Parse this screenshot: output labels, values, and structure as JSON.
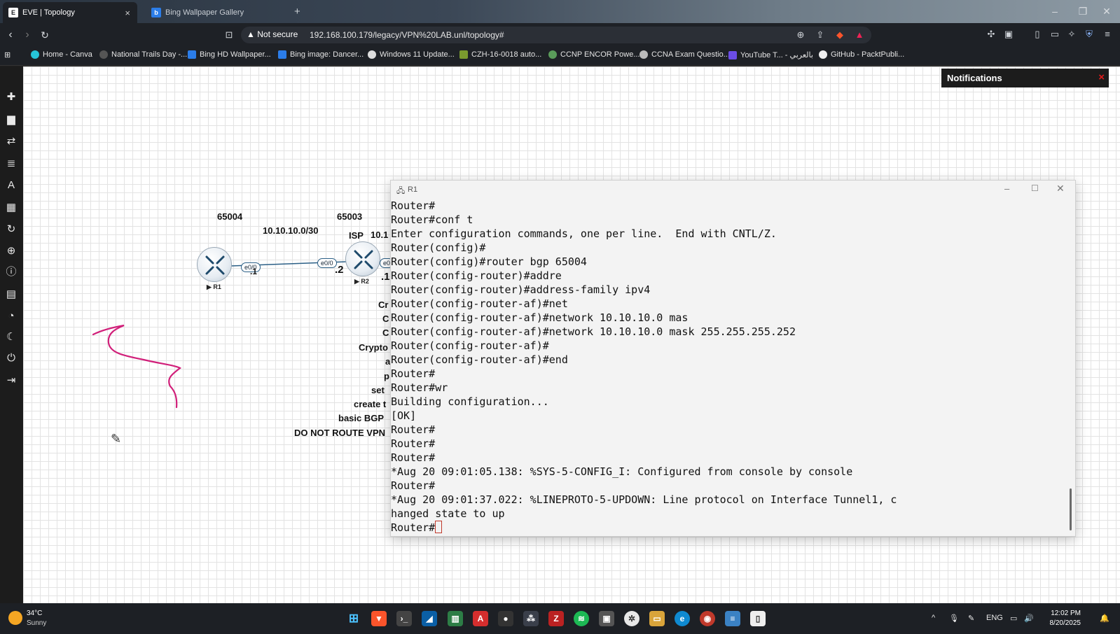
{
  "browser": {
    "tabs": [
      {
        "title": "EVE | Topology",
        "active": true
      },
      {
        "title": "Bing Wallpaper Gallery",
        "active": false
      }
    ],
    "new_tab": "+",
    "security_label": "Not secure",
    "url": "192.168.100.179/legacy/VPN%20LAB.unl/topology#",
    "bookmarks": [
      "Home - Canva",
      "National Trails Day -...",
      "Bing HD Wallpaper...",
      "Bing image: Dancer...",
      "Windows 11 Update...",
      "CZH-16-0018 auto...",
      "CCNP ENCOR Powe...",
      "CCNA Exam Questio...",
      "YouTube T... - بالعربي",
      "GitHub - PacktPubli..."
    ]
  },
  "notifications": {
    "title": "Notifications",
    "close": "×"
  },
  "topology": {
    "as_left": "65004",
    "as_right": "65003",
    "link_subnet": "10.10.10.0/30",
    "isp_label": "ISP",
    "isp_ip_partial": "10.1",
    "r1_iface": "e0/0",
    "r2_iface": "e0/0",
    "r2_iface_right": "e0",
    "r1_host": ".1",
    "r2_host": ".2",
    "r2_host_right": ".1",
    "r1_name": "R1",
    "r2_name": "R2",
    "notes": [
      "Cr",
      "C",
      "C",
      "Crypto",
      "a",
      "p",
      "set",
      "create t",
      "basic BGP",
      "DO NOT ROUTE VPN"
    ]
  },
  "console": {
    "title": "R1",
    "lines": [
      "Router#",
      "Router#conf t",
      "Enter configuration commands, one per line.  End with CNTL/Z.",
      "Router(config)#",
      "Router(config)#router bgp 65004",
      "Router(config-router)#addre",
      "Router(config-router)#address-family ipv4",
      "Router(config-router-af)#net",
      "Router(config-router-af)#network 10.10.10.0 mas",
      "Router(config-router-af)#network 10.10.10.0 mask 255.255.255.252",
      "Router(config-router-af)#",
      "Router(config-router-af)#end",
      "Router#",
      "Router#wr",
      "Building configuration...",
      "[OK]",
      "Router#",
      "Router#",
      "Router#",
      "*Aug 20 09:01:05.138: %SYS-5-CONFIG_I: Configured from console by console",
      "Router#",
      "*Aug 20 09:01:37.022: %LINEPROTO-5-UPDOWN: Line protocol on Interface Tunnel1, c",
      "hanged state to up"
    ],
    "prompt": "Router#"
  },
  "taskbar": {
    "weather_temp": "34°C",
    "weather_desc": "Sunny",
    "lang": "ENG",
    "time": "12:02 PM",
    "date": "8/20/2025"
  },
  "colors": {
    "annotation": "#d1207a",
    "accent_red": "#e21b1b"
  }
}
